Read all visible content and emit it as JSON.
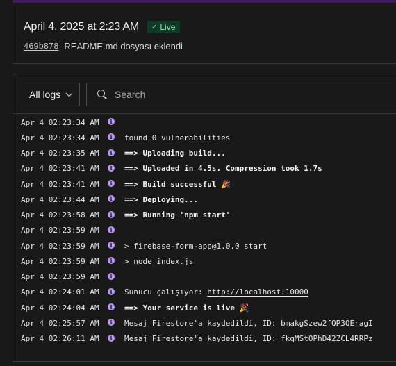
{
  "deploy": {
    "timestamp": "April 4, 2025 at 2:23 AM",
    "status": "Live",
    "commit_hash": "469b878",
    "commit_message": "README.md dosyası eklendi",
    "colors": {
      "live_bg": "#0f3b26",
      "live_text": "#8de0b0",
      "strip": "#3f1b5c"
    }
  },
  "logs_toolbar": {
    "filter_label": "All logs",
    "search_placeholder": "Search"
  },
  "logs": [
    {
      "time": "Apr 4 02:23:34 AM",
      "arrow": "",
      "message": "",
      "bold": false
    },
    {
      "time": "Apr 4 02:23:34 AM",
      "arrow": "",
      "message": "found 0 vulnerabilities",
      "bold": false
    },
    {
      "time": "Apr 4 02:23:35 AM",
      "arrow": "==>",
      "arrow_color": "blue",
      "message": "Uploading build...",
      "bold": true
    },
    {
      "time": "Apr 4 02:23:41 AM",
      "arrow": "==>",
      "arrow_color": "blue",
      "message": "Uploaded in 4.5s. Compression took 1.7s",
      "bold": true
    },
    {
      "time": "Apr 4 02:23:41 AM",
      "arrow": "==>",
      "arrow_color": "green",
      "message": "Build successful 🎉",
      "bold": true
    },
    {
      "time": "Apr 4 02:23:44 AM",
      "arrow": "==>",
      "arrow_color": "blue",
      "message": "Deploying...",
      "bold": true
    },
    {
      "time": "Apr 4 02:23:58 AM",
      "arrow": "==>",
      "arrow_color": "blue",
      "message": "Running 'npm start'",
      "bold": true
    },
    {
      "time": "Apr 4 02:23:59 AM",
      "arrow": "",
      "message": "",
      "bold": false
    },
    {
      "time": "Apr 4 02:23:59 AM",
      "arrow": "",
      "message": "> firebase-form-app@1.0.0 start",
      "bold": false
    },
    {
      "time": "Apr 4 02:23:59 AM",
      "arrow": "",
      "message": "> node index.js",
      "bold": false
    },
    {
      "time": "Apr 4 02:23:59 AM",
      "arrow": "",
      "message": "",
      "bold": false
    },
    {
      "time": "Apr 4 02:24:01 AM",
      "arrow": "",
      "message": "Sunucu çalışıyor: ",
      "link": "http://localhost:10000",
      "bold": false
    },
    {
      "time": "Apr 4 02:24:04 AM",
      "arrow": "==>",
      "arrow_color": "green",
      "message": "Your service is live 🎉",
      "bold": true
    },
    {
      "time": "Apr 4 02:25:57 AM",
      "arrow": "",
      "message": "Mesaj Firestore'a kaydedildi, ID: bmakgSzew2fQP3QEragI",
      "bold": false
    },
    {
      "time": "Apr 4 02:26:11 AM",
      "arrow": "",
      "message": "Mesaj Firestore'a kaydedildi, ID: fkqMStOPhD42ZCL4RRPz",
      "bold": false
    }
  ],
  "icons": {
    "info": "info-icon",
    "search": "search-icon",
    "chevron": "chevron-down-icon",
    "check": "check-icon"
  }
}
